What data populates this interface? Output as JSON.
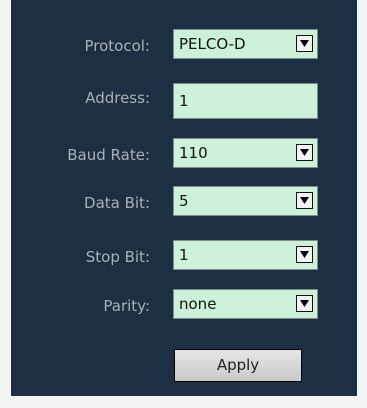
{
  "form": {
    "protocol": {
      "label": "Protocol:",
      "value": "PELCO-D"
    },
    "address": {
      "label": "Address:",
      "value": "1"
    },
    "baud_rate": {
      "label": "Baud Rate:",
      "value": "110"
    },
    "data_bit": {
      "label": "Data Bit:",
      "value": "5"
    },
    "stop_bit": {
      "label": "Stop Bit:",
      "value": "1"
    },
    "parity": {
      "label": "Parity:",
      "value": "none"
    },
    "apply_label": "Apply"
  },
  "icons": {
    "dropdown": "chevron-down-icon"
  },
  "colors": {
    "panel_bg": "#1d3043",
    "field_bg": "#ccf1d8",
    "label_text": "#a9b0b8"
  }
}
